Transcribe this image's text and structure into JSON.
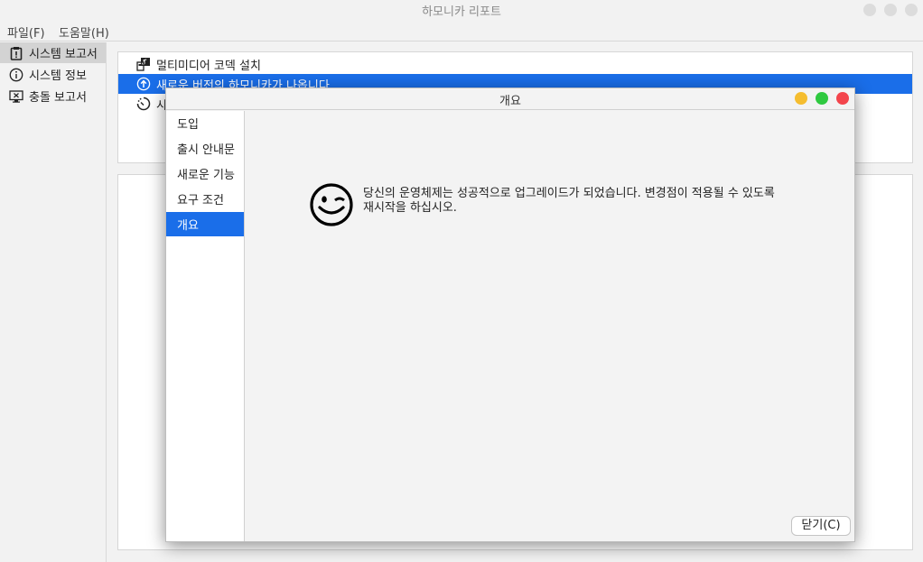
{
  "window": {
    "title": "하모니카 리포트"
  },
  "menubar": {
    "items": [
      "파일(F)",
      "도움말(H)"
    ]
  },
  "sidebar": {
    "items": [
      {
        "label": "시스템 보고서",
        "icon": "clipboard-icon",
        "selected": true
      },
      {
        "label": "시스템 정보",
        "icon": "info-icon",
        "selected": false
      },
      {
        "label": "충돌 보고서",
        "icon": "monitor-crash-icon",
        "selected": false
      }
    ]
  },
  "reports": {
    "rows": [
      {
        "label": "멀티미디어 코덱 설치",
        "icon": "codec-icon",
        "selected": false
      },
      {
        "label": "새로운 버전의 하모니카가 나옵니다",
        "icon": "upgrade-arrow-icon",
        "selected": true
      },
      {
        "label": "시",
        "icon": "spinner-icon",
        "selected": false
      }
    ]
  },
  "dialog": {
    "title": "개요",
    "nav": [
      {
        "label": "도입",
        "selected": false
      },
      {
        "label": "출시 안내문",
        "selected": false
      },
      {
        "label": "새로운 기능",
        "selected": false
      },
      {
        "label": "요구 조건",
        "selected": false
      },
      {
        "label": "개요",
        "selected": true
      }
    ],
    "message": "당신의 운영체제는 성공적으로 업그레이드가 되었습니다. 변경점이 적용될 수 있도록 재시작을 하십시오.",
    "close_label": "닫기(C)",
    "colors": {
      "minimize": "#f5bd2f",
      "maximize": "#2fc940",
      "close": "#f3454c"
    }
  },
  "colors": {
    "accent": "#1a6ee9"
  }
}
